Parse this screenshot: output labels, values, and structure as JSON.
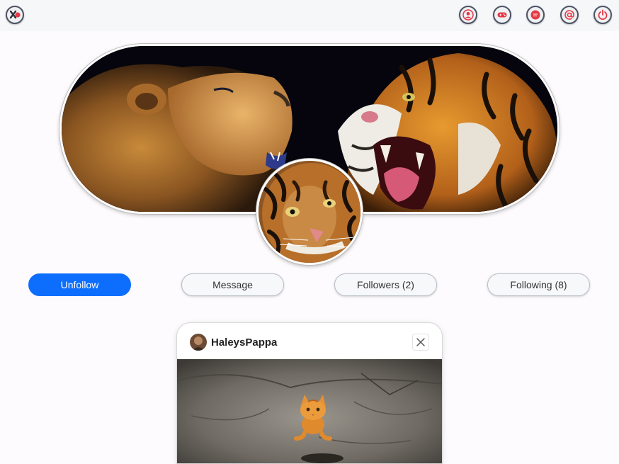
{
  "topbar": {
    "left_icon": "logo-x-icon",
    "right_icons": [
      "profile-icon",
      "gamepad-icon",
      "chat-icon",
      "at-mention-icon",
      "power-icon"
    ],
    "icon_accent": "#e53946",
    "icon_border": "#4c5363"
  },
  "profile": {
    "banner_image": "lion-and-tiger-banner",
    "avatar_image": "tiger-face-avatar",
    "actions": {
      "unfollow": "Unfollow",
      "message": "Message",
      "followers": "Followers (2)",
      "following": "Following (8)"
    },
    "primary_color": "#0d6efd"
  },
  "post": {
    "username": "HaleysPappa",
    "close_icon": "close-icon",
    "image": "orange-kitten-on-rock"
  }
}
